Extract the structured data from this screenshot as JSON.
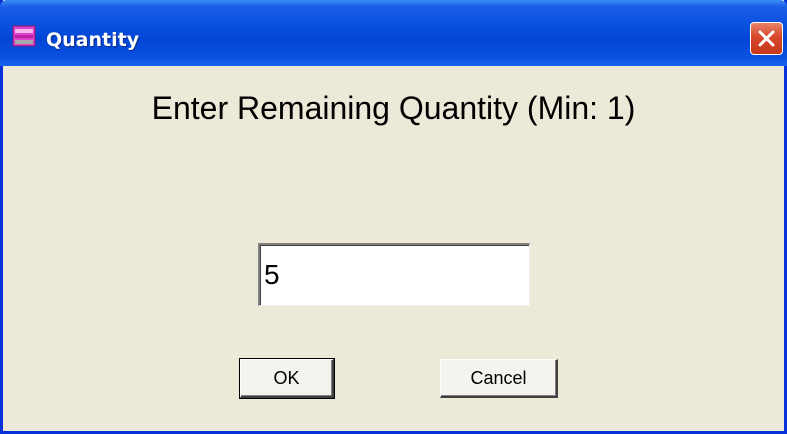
{
  "window": {
    "title": "Quantity",
    "title_icon": "app-window-icon",
    "close_icon": "close-icon"
  },
  "dialog": {
    "prompt": "Enter Remaining Quantity (Min: 1)",
    "quantity_value": "5"
  },
  "buttons": {
    "ok_label": "OK",
    "cancel_label": "Cancel"
  },
  "colors": {
    "titlebar": "#0a50e0",
    "dialog_background": "#ece9d8",
    "close_button": "#d8462a"
  }
}
